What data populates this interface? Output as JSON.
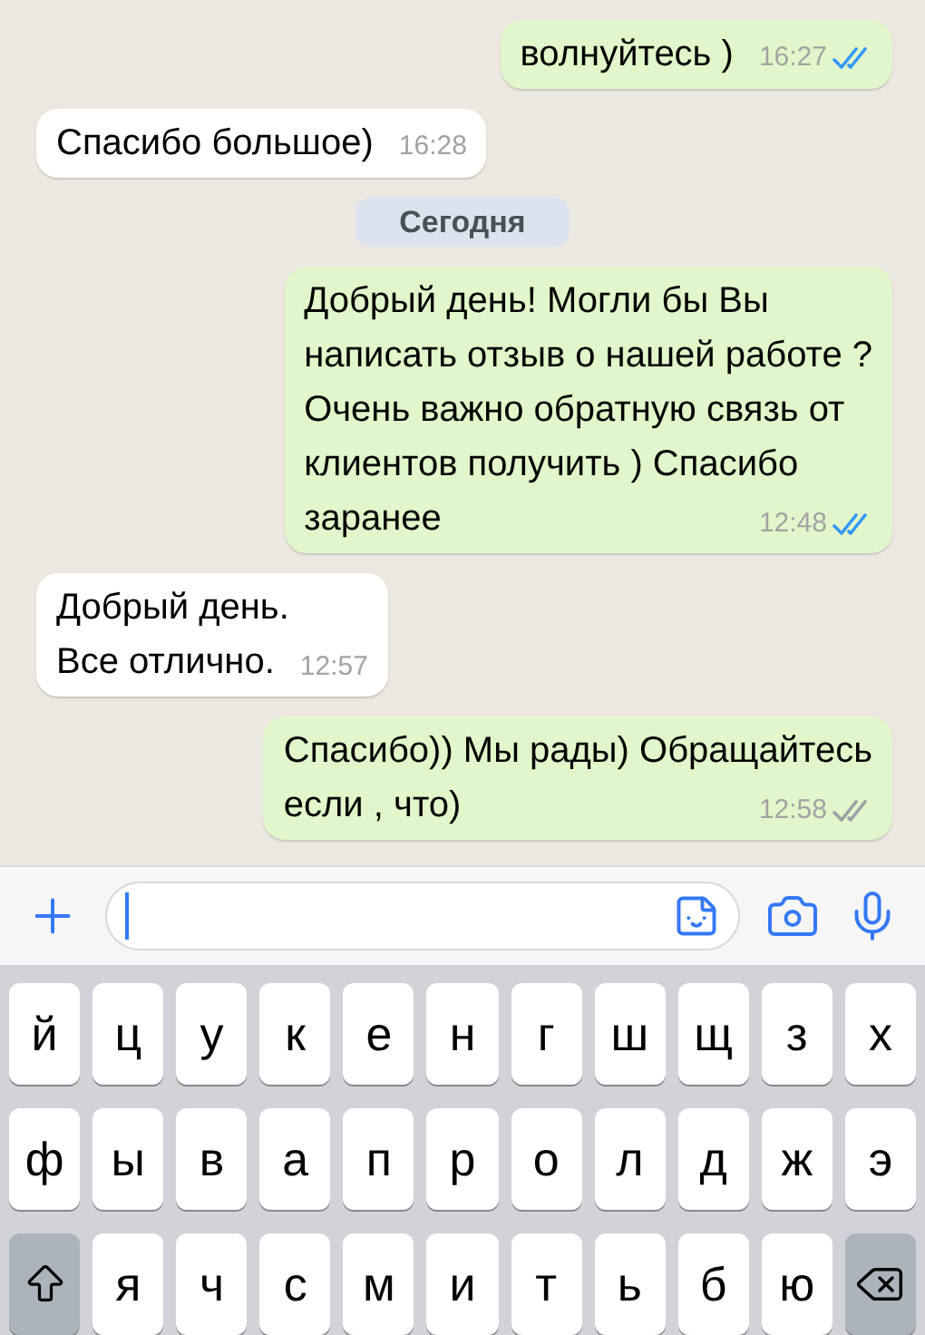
{
  "chat": [
    {
      "kind": "outgoing",
      "lines": [
        "волнуйтесь )"
      ],
      "time": "16:27",
      "read": true
    },
    {
      "kind": "incoming",
      "lines": [
        "Спасибо большое)"
      ],
      "time": "16:28"
    },
    {
      "kind": "date",
      "text": "Сегодня"
    },
    {
      "kind": "outgoing",
      "lines": [
        "Добрый день! Могли бы Вы",
        "написать отзыв о нашей работе ?",
        "Очень важно обратную связь от",
        "клиентов получить ) Спасибо",
        "заранее"
      ],
      "time": "12:48",
      "read": true
    },
    {
      "kind": "incoming",
      "lines": [
        "Добрый день.",
        "Все отлично."
      ],
      "time": "12:57"
    },
    {
      "kind": "outgoing",
      "lines": [
        "Спасибо)) Мы рады) Обращайтесь",
        "если , что)"
      ],
      "time": "12:58",
      "read": false
    }
  ],
  "keyboard": {
    "rows": [
      [
        {
          "kind": "letter",
          "label": "й"
        },
        {
          "kind": "letter",
          "label": "ц"
        },
        {
          "kind": "letter",
          "label": "у"
        },
        {
          "kind": "letter",
          "label": "к"
        },
        {
          "kind": "letter",
          "label": "е"
        },
        {
          "kind": "letter",
          "label": "н"
        },
        {
          "kind": "letter",
          "label": "г"
        },
        {
          "kind": "letter",
          "label": "ш"
        },
        {
          "kind": "letter",
          "label": "щ"
        },
        {
          "kind": "letter",
          "label": "з"
        },
        {
          "kind": "letter",
          "label": "х"
        }
      ],
      [
        {
          "kind": "letter",
          "label": "ф"
        },
        {
          "kind": "letter",
          "label": "ы"
        },
        {
          "kind": "letter",
          "label": "в"
        },
        {
          "kind": "letter",
          "label": "а"
        },
        {
          "kind": "letter",
          "label": "п"
        },
        {
          "kind": "letter",
          "label": "р"
        },
        {
          "kind": "letter",
          "label": "о"
        },
        {
          "kind": "letter",
          "label": "л"
        },
        {
          "kind": "letter",
          "label": "д"
        },
        {
          "kind": "letter",
          "label": "ж"
        },
        {
          "kind": "letter",
          "label": "э"
        }
      ],
      [
        {
          "kind": "shift"
        },
        {
          "kind": "letter",
          "label": "я"
        },
        {
          "kind": "letter",
          "label": "ч"
        },
        {
          "kind": "letter",
          "label": "с"
        },
        {
          "kind": "letter",
          "label": "м"
        },
        {
          "kind": "letter",
          "label": "и"
        },
        {
          "kind": "letter",
          "label": "т"
        },
        {
          "kind": "letter",
          "label": "ь"
        },
        {
          "kind": "letter",
          "label": "б"
        },
        {
          "kind": "letter",
          "label": "ю"
        },
        {
          "kind": "backspace"
        }
      ]
    ]
  }
}
